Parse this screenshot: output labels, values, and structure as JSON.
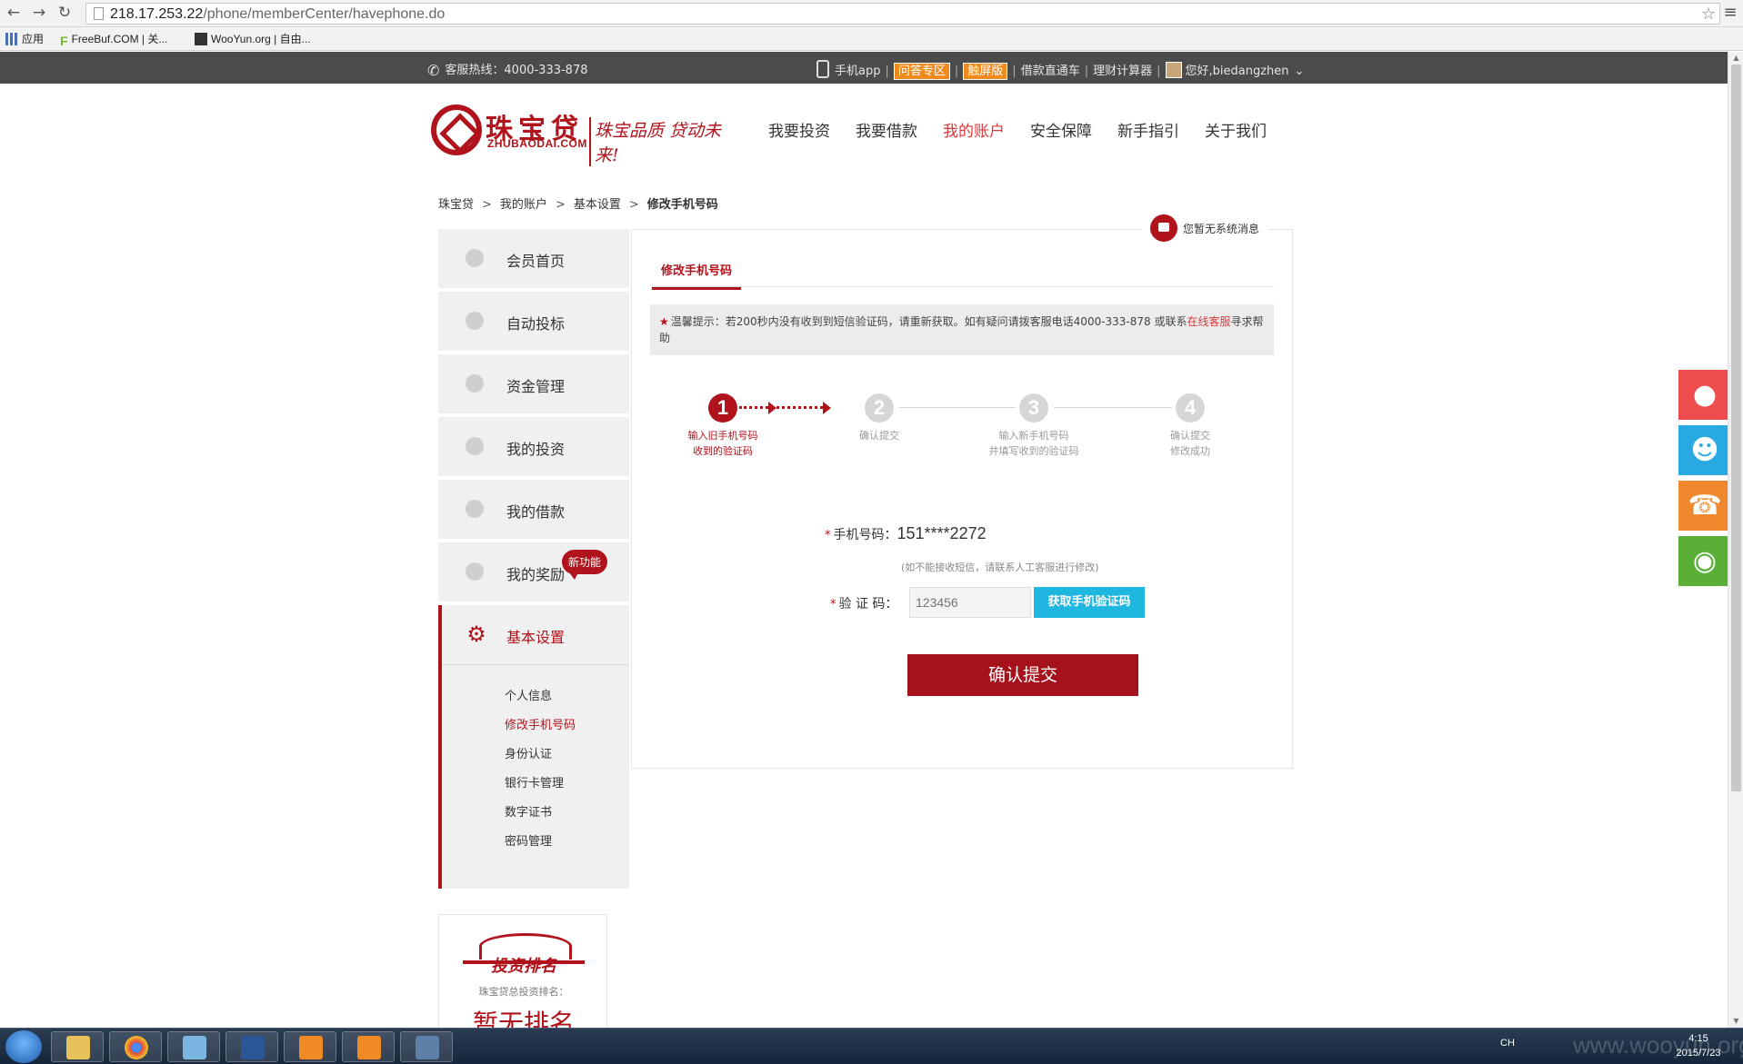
{
  "browser": {
    "url_host": "218.17.253.22",
    "url_path": "/phone/memberCenter/havephone.do",
    "bookmarks": [
      "应用",
      "FreeBuf.COM | 关...",
      "WooYun.org | 自由..."
    ]
  },
  "topbar": {
    "hotline": "客服热线：4000-333-878",
    "app": "手机app",
    "qa": "问答专区",
    "touch": "触屏版",
    "loan_train": "借款直通车",
    "calculator": "理财计算器",
    "greeting": "您好,biedangzhen"
  },
  "header": {
    "logo_cn": "珠宝贷",
    "logo_en": "ZHUBAODAI.COM",
    "slogan": "珠宝品质 贷动未来!",
    "nav": [
      "我要投资",
      "我要借款",
      "我的账户",
      "安全保障",
      "新手指引",
      "关于我们"
    ],
    "active_nav": "我的账户"
  },
  "breadcrumb": [
    "珠宝贷",
    "我的账户",
    "基本设置",
    "修改手机号码"
  ],
  "sidebar": {
    "items": [
      "会员首页",
      "自动投标",
      "资金管理",
      "我的投资",
      "我的借款",
      "我的奖励"
    ],
    "new_badge": "新功能",
    "active_section": "基本设置",
    "sub_items": [
      "个人信息",
      "修改手机号码",
      "身份认证",
      "银行卡管理",
      "数字证书",
      "密码管理"
    ],
    "active_sub": "修改手机号码"
  },
  "rank": {
    "title": "投资排名",
    "subtitle": "珠宝贷总投资排名：",
    "value": "暂无排名"
  },
  "main": {
    "message": "您暂无系统消息",
    "tab": "修改手机号码",
    "tip_prefix": "温馨提示：若200秒内没有收到到短信验证码，请重新获取。如有疑问请拨客服电话4000-333-878 或联系",
    "tip_link": "在线客服",
    "tip_suffix": "寻求帮助",
    "steps": [
      {
        "num": "1",
        "label1": "输入旧手机号码",
        "label2": "收到的验证码"
      },
      {
        "num": "2",
        "label1": "确认提交",
        "label2": ""
      },
      {
        "num": "3",
        "label1": "输入新手机号码",
        "label2": "并填写收到的验证码"
      },
      {
        "num": "4",
        "label1": "确认提交",
        "label2": "修改成功"
      }
    ],
    "active_step": 1,
    "phone_label": "手机号码：",
    "phone_value": "151****2272",
    "note": "(如不能接收短信，请联系人工客服进行修改)",
    "code_label": "验 证 码：",
    "code_placeholder": "123456",
    "get_code_btn": "获取手机验证码",
    "submit_btn": "确认提交"
  },
  "taskbar": {
    "tray": "CH",
    "time": "4:15",
    "date": "2015/7/23"
  },
  "watermark": "www.wooyun.org",
  "colors": {
    "brand": "#b0131c",
    "nav_active": "#d9383b",
    "code_button": "#1fb6e0",
    "qq": "#ef4d4d",
    "service": "#29a9e1",
    "phone": "#f0882d",
    "wechat": "#5ab037"
  }
}
